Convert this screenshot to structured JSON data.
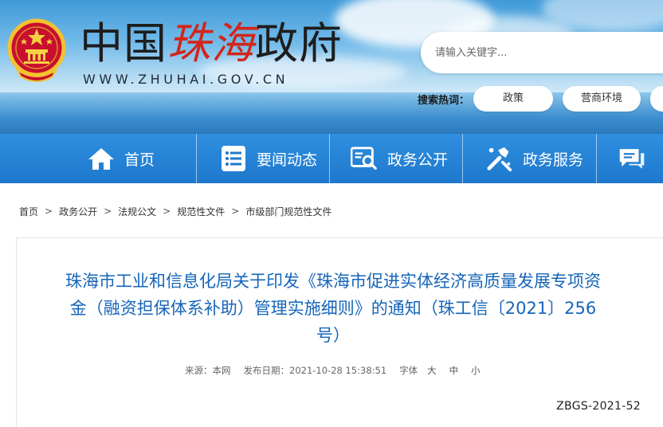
{
  "header": {
    "site_title_part1": "中国",
    "site_title_part2": "珠海",
    "site_title_part3": "政府",
    "site_domain": "WWW.ZHUHAI.GOV.CN",
    "search": {
      "placeholder": "请输入关键字..."
    },
    "hot_search_label": "搜索热词：",
    "hot_tags": [
      "政策",
      "营商环境"
    ]
  },
  "nav": {
    "items": [
      {
        "label": "首页",
        "icon": "home-icon"
      },
      {
        "label": "要闻动态",
        "icon": "news-list-icon"
      },
      {
        "label": "政务公开",
        "icon": "search-doc-icon"
      },
      {
        "label": "政务服务",
        "icon": "service-tools-icon"
      },
      {
        "label": "",
        "icon": "chat-icon"
      }
    ]
  },
  "breadcrumb": [
    "首页",
    "政务公开",
    "法规公文",
    "规范性文件",
    "市级部门规范性文件"
  ],
  "breadcrumb_sep": ">",
  "article": {
    "title_line1": "珠海市工业和信息化局关于印发《珠海市促进实体经济高质量发展专项资",
    "title_line2": "金（融资担保体系补助）管理实施细则》的通知（珠工信〔2021〕256",
    "title_line3": "号）",
    "source_label": "来源：",
    "source_value": "本网",
    "date_label": "发布日期：",
    "date_value": "2021-10-28 15:38:51",
    "font_label": "字体",
    "font_sizes": [
      "大",
      "中",
      "小"
    ],
    "doc_code": "ZBGS-2021-52"
  },
  "colors": {
    "nav_bg": "#1d78cc",
    "title_blue": "#1565b8",
    "accent_red": "#d32519"
  }
}
